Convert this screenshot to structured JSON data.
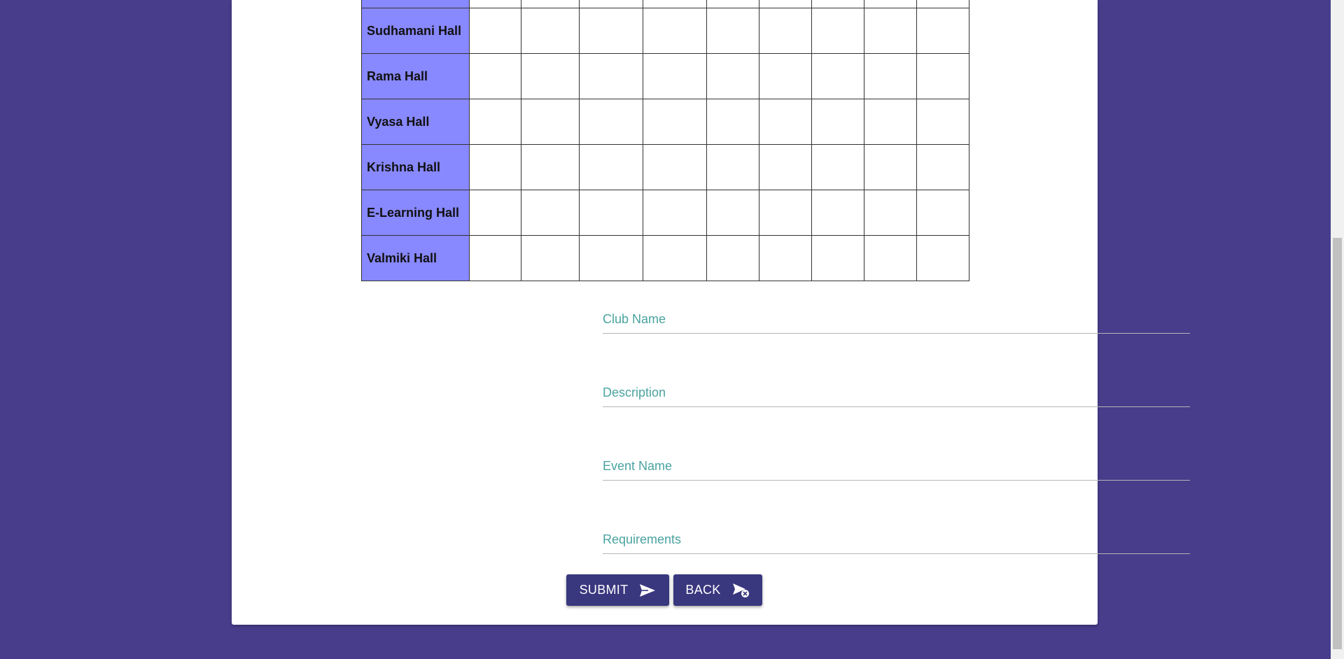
{
  "halls": {
    "rows": [
      {
        "name": "Sudhamani Hall"
      },
      {
        "name": "Rama Hall"
      },
      {
        "name": "Vyasa Hall"
      },
      {
        "name": "Krishna Hall"
      },
      {
        "name": "E-Learning Hall"
      },
      {
        "name": "Valmiki Hall"
      }
    ]
  },
  "form": {
    "club_name": {
      "placeholder": "Club Name",
      "value": ""
    },
    "description": {
      "placeholder": "Description",
      "value": ""
    },
    "event_name": {
      "placeholder": "Event Name",
      "value": ""
    },
    "requirements": {
      "placeholder": "Requirements",
      "value": ""
    }
  },
  "buttons": {
    "submit": {
      "label": "SUBMIT",
      "icon": "send-icon"
    },
    "back": {
      "label": "BACK",
      "icon": "cancel-send-icon"
    }
  },
  "colors": {
    "page_background": "#473d8b",
    "hall_cell": "#8888ff",
    "button": "#39377e",
    "placeholder": "#4aa3a0"
  }
}
